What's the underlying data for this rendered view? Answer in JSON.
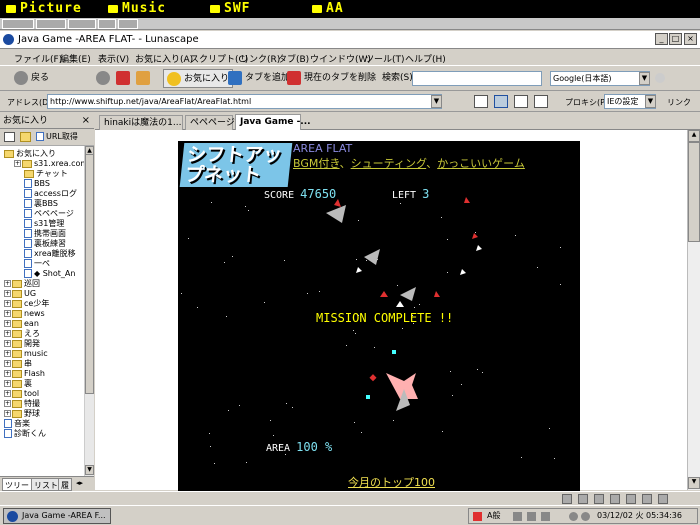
{
  "top_tabs": [
    "Picture",
    "Music",
    "SWF",
    "AA"
  ],
  "window_title": "Java Game -AREA FLAT- - Lunascape",
  "menu": [
    "ファイル(F)",
    "編集(E)",
    "表示(V)",
    "お気に入り(A)",
    "スクリプト(C)",
    "リンク(R)",
    "タブ(B)",
    "ウインドウ(W)",
    "ツール(T)",
    "ヘルプ(H)"
  ],
  "toolbar": {
    "back": "戻る",
    "favorites": "お気に入り",
    "add_tab": "タブを追加",
    "close_tab": "現在のタブを削除",
    "search_label": "検索(S)",
    "search_engine": "Google(日本語)"
  },
  "address": {
    "label": "アドレス(D)",
    "url": "http://www.shiftup.net/java/AreaFlat/AreaFlat.html",
    "proxy_label": "プロキシ(P)",
    "proxy_value": "IEの設定",
    "link_label": "リンク"
  },
  "sidebar": {
    "title": "お気に入り",
    "url_button": "URL取得",
    "tree": [
      {
        "label": "お気に入り",
        "type": "folder",
        "indent": 0
      },
      {
        "label": "s31.xrea.com",
        "type": "folder",
        "indent": 1
      },
      {
        "label": "チャット",
        "type": "folder",
        "indent": 2
      },
      {
        "label": "BBS",
        "type": "page",
        "indent": 2
      },
      {
        "label": "accessログ",
        "type": "page",
        "indent": 2
      },
      {
        "label": "裏BBS",
        "type": "page",
        "indent": 2
      },
      {
        "label": "ペペページ",
        "type": "page",
        "indent": 2
      },
      {
        "label": "s31管理",
        "type": "page",
        "indent": 2
      },
      {
        "label": "携帯画面",
        "type": "page",
        "indent": 2
      },
      {
        "label": "裏板練習",
        "type": "page",
        "indent": 2
      },
      {
        "label": "xrea離脱移",
        "type": "page",
        "indent": 2
      },
      {
        "label": "一ペ",
        "type": "page",
        "indent": 2
      },
      {
        "label": "◆ Shot_An",
        "type": "page",
        "indent": 2
      },
      {
        "label": "巡回",
        "type": "folder",
        "indent": 0
      },
      {
        "label": "UG",
        "type": "folder",
        "indent": 0
      },
      {
        "label": "ce少年",
        "type": "folder",
        "indent": 0
      },
      {
        "label": "news",
        "type": "folder",
        "indent": 0
      },
      {
        "label": "ean",
        "type": "folder",
        "indent": 0
      },
      {
        "label": "えろ",
        "type": "folder",
        "indent": 0
      },
      {
        "label": "開発",
        "type": "folder",
        "indent": 0
      },
      {
        "label": "music",
        "type": "folder",
        "indent": 0
      },
      {
        "label": "串",
        "type": "folder",
        "indent": 0
      },
      {
        "label": "Flash",
        "type": "folder",
        "indent": 0
      },
      {
        "label": "裏",
        "type": "folder",
        "indent": 0
      },
      {
        "label": "tool",
        "type": "folder",
        "indent": 0
      },
      {
        "label": "特撮",
        "type": "folder",
        "indent": 0
      },
      {
        "label": "野球",
        "type": "folder",
        "indent": 0
      },
      {
        "label": "音楽",
        "type": "page",
        "indent": 0
      },
      {
        "label": "診断くん",
        "type": "page",
        "indent": 0
      }
    ],
    "bottom_tabs": [
      "ツリー",
      "リスト",
      "履"
    ]
  },
  "doc_tabs": [
    "hinakiは魔法の1...",
    "ペペページ",
    "Java Game -..."
  ],
  "game": {
    "logo": "シフトアップネット",
    "title": "AREA FLAT",
    "link1": "BGM付き",
    "link2": "シューティング",
    "link3": "かっこいいゲーム",
    "score_label": "SCORE",
    "score_value": "47650",
    "left_label": "LEFT",
    "left_value": "3",
    "mission": "MISSION COMPLETE !!",
    "area_label": "AREA",
    "area_value": "100 %",
    "top100": "今月のトップ100"
  },
  "taskbar": {
    "task": "Java Game -AREA F...",
    "tray_ime": "A般",
    "clock": "03/12/02 火 05:34:36"
  }
}
